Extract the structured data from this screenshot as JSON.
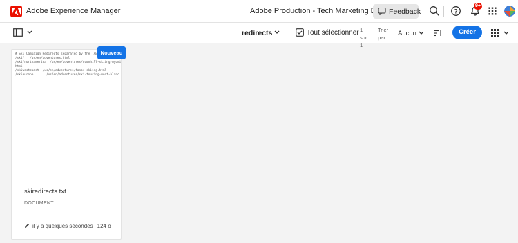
{
  "header": {
    "app_name": "Adobe Experience Manager",
    "org_name": "Adobe Production - Tech Marketing Demos",
    "feedback_label": "Feedback",
    "notification_badge": "9+",
    "icons": [
      "adobe-logo-icon",
      "feedback-icon",
      "search-icon",
      "help-icon",
      "bell-icon",
      "app-grid-icon"
    ],
    "accent": "#eb1000"
  },
  "actionbar": {
    "folder_title": "redirects",
    "select_all_label": "Tout sélectionner",
    "count_text": "1 sur 1",
    "sort_label": "Trier par",
    "sort_value": "Aucun",
    "create_label": "Créer",
    "create_color": "#1473e6"
  },
  "asset_card": {
    "new_badge": "Nouveau",
    "preview_lines": [
      "# Ski Campaign Redirects separated by the TAB",
      "/ski/   /us/en/adventures.html",
      "/ski/northamerica  /us/en/adventures/downhill-skiing-wyoming.",
      "html",
      "/skiwestcoast  /us/en/adventures/fanos-skiing.html",
      "/skieurope       /us/en/adventures/ski-touring-mont-blanc.html"
    ],
    "file_name": "skiredirects.txt",
    "file_type": "DOCUMENT",
    "modified": "il y a quelques secondes",
    "size": "124 o"
  }
}
